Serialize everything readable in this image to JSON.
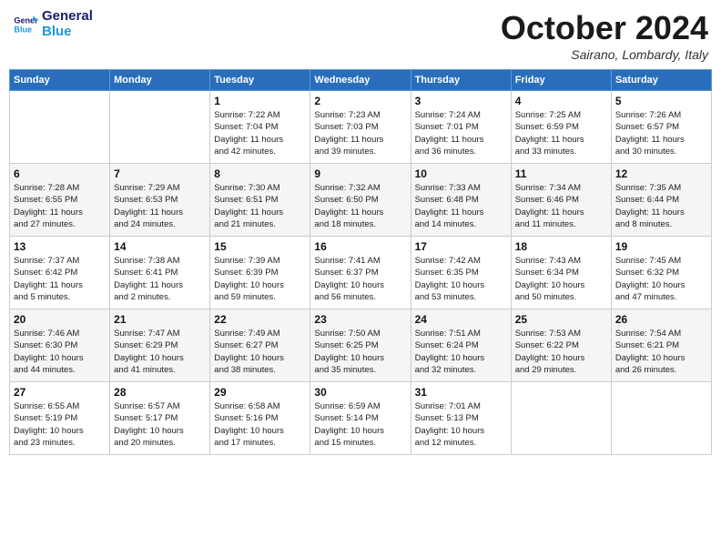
{
  "header": {
    "logo_line1": "General",
    "logo_line2": "Blue",
    "month": "October 2024",
    "location": "Sairano, Lombardy, Italy"
  },
  "weekdays": [
    "Sunday",
    "Monday",
    "Tuesday",
    "Wednesday",
    "Thursday",
    "Friday",
    "Saturday"
  ],
  "weeks": [
    [
      {
        "day": "",
        "info": ""
      },
      {
        "day": "",
        "info": ""
      },
      {
        "day": "1",
        "info": "Sunrise: 7:22 AM\nSunset: 7:04 PM\nDaylight: 11 hours\nand 42 minutes."
      },
      {
        "day": "2",
        "info": "Sunrise: 7:23 AM\nSunset: 7:03 PM\nDaylight: 11 hours\nand 39 minutes."
      },
      {
        "day": "3",
        "info": "Sunrise: 7:24 AM\nSunset: 7:01 PM\nDaylight: 11 hours\nand 36 minutes."
      },
      {
        "day": "4",
        "info": "Sunrise: 7:25 AM\nSunset: 6:59 PM\nDaylight: 11 hours\nand 33 minutes."
      },
      {
        "day": "5",
        "info": "Sunrise: 7:26 AM\nSunset: 6:57 PM\nDaylight: 11 hours\nand 30 minutes."
      }
    ],
    [
      {
        "day": "6",
        "info": "Sunrise: 7:28 AM\nSunset: 6:55 PM\nDaylight: 11 hours\nand 27 minutes."
      },
      {
        "day": "7",
        "info": "Sunrise: 7:29 AM\nSunset: 6:53 PM\nDaylight: 11 hours\nand 24 minutes."
      },
      {
        "day": "8",
        "info": "Sunrise: 7:30 AM\nSunset: 6:51 PM\nDaylight: 11 hours\nand 21 minutes."
      },
      {
        "day": "9",
        "info": "Sunrise: 7:32 AM\nSunset: 6:50 PM\nDaylight: 11 hours\nand 18 minutes."
      },
      {
        "day": "10",
        "info": "Sunrise: 7:33 AM\nSunset: 6:48 PM\nDaylight: 11 hours\nand 14 minutes."
      },
      {
        "day": "11",
        "info": "Sunrise: 7:34 AM\nSunset: 6:46 PM\nDaylight: 11 hours\nand 11 minutes."
      },
      {
        "day": "12",
        "info": "Sunrise: 7:35 AM\nSunset: 6:44 PM\nDaylight: 11 hours\nand 8 minutes."
      }
    ],
    [
      {
        "day": "13",
        "info": "Sunrise: 7:37 AM\nSunset: 6:42 PM\nDaylight: 11 hours\nand 5 minutes."
      },
      {
        "day": "14",
        "info": "Sunrise: 7:38 AM\nSunset: 6:41 PM\nDaylight: 11 hours\nand 2 minutes."
      },
      {
        "day": "15",
        "info": "Sunrise: 7:39 AM\nSunset: 6:39 PM\nDaylight: 10 hours\nand 59 minutes."
      },
      {
        "day": "16",
        "info": "Sunrise: 7:41 AM\nSunset: 6:37 PM\nDaylight: 10 hours\nand 56 minutes."
      },
      {
        "day": "17",
        "info": "Sunrise: 7:42 AM\nSunset: 6:35 PM\nDaylight: 10 hours\nand 53 minutes."
      },
      {
        "day": "18",
        "info": "Sunrise: 7:43 AM\nSunset: 6:34 PM\nDaylight: 10 hours\nand 50 minutes."
      },
      {
        "day": "19",
        "info": "Sunrise: 7:45 AM\nSunset: 6:32 PM\nDaylight: 10 hours\nand 47 minutes."
      }
    ],
    [
      {
        "day": "20",
        "info": "Sunrise: 7:46 AM\nSunset: 6:30 PM\nDaylight: 10 hours\nand 44 minutes."
      },
      {
        "day": "21",
        "info": "Sunrise: 7:47 AM\nSunset: 6:29 PM\nDaylight: 10 hours\nand 41 minutes."
      },
      {
        "day": "22",
        "info": "Sunrise: 7:49 AM\nSunset: 6:27 PM\nDaylight: 10 hours\nand 38 minutes."
      },
      {
        "day": "23",
        "info": "Sunrise: 7:50 AM\nSunset: 6:25 PM\nDaylight: 10 hours\nand 35 minutes."
      },
      {
        "day": "24",
        "info": "Sunrise: 7:51 AM\nSunset: 6:24 PM\nDaylight: 10 hours\nand 32 minutes."
      },
      {
        "day": "25",
        "info": "Sunrise: 7:53 AM\nSunset: 6:22 PM\nDaylight: 10 hours\nand 29 minutes."
      },
      {
        "day": "26",
        "info": "Sunrise: 7:54 AM\nSunset: 6:21 PM\nDaylight: 10 hours\nand 26 minutes."
      }
    ],
    [
      {
        "day": "27",
        "info": "Sunrise: 6:55 AM\nSunset: 5:19 PM\nDaylight: 10 hours\nand 23 minutes."
      },
      {
        "day": "28",
        "info": "Sunrise: 6:57 AM\nSunset: 5:17 PM\nDaylight: 10 hours\nand 20 minutes."
      },
      {
        "day": "29",
        "info": "Sunrise: 6:58 AM\nSunset: 5:16 PM\nDaylight: 10 hours\nand 17 minutes."
      },
      {
        "day": "30",
        "info": "Sunrise: 6:59 AM\nSunset: 5:14 PM\nDaylight: 10 hours\nand 15 minutes."
      },
      {
        "day": "31",
        "info": "Sunrise: 7:01 AM\nSunset: 5:13 PM\nDaylight: 10 hours\nand 12 minutes."
      },
      {
        "day": "",
        "info": ""
      },
      {
        "day": "",
        "info": ""
      }
    ]
  ]
}
